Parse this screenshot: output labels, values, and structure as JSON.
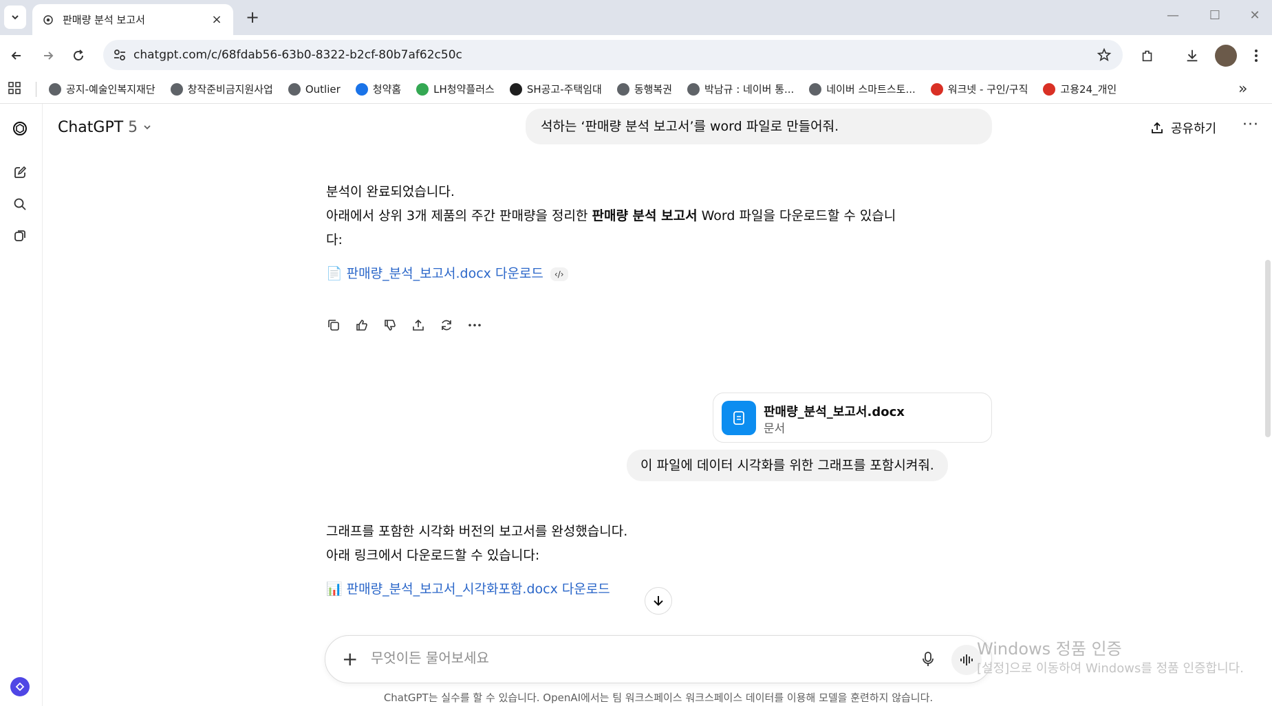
{
  "browser": {
    "tab_title": "판매량 분석 보고서",
    "close_glyph": "×",
    "new_tab_glyph": "+",
    "url": "chatgpt.com/c/68fdab56-63b0-8322-b2cf-80b7af62c50c",
    "bookmarks": [
      {
        "label": "공지-예술인복지재단",
        "color": "#5f6368"
      },
      {
        "label": "창작준비금지원사업",
        "color": "#5f6368"
      },
      {
        "label": "Outlier",
        "color": "#5f6368"
      },
      {
        "label": "청약홈",
        "color": "#1a73e8"
      },
      {
        "label": "LH청약플러스",
        "color": "#34a853"
      },
      {
        "label": "SH공고-주택임대",
        "color": "#1f1f1f"
      },
      {
        "label": "동행복권",
        "color": "#5f6368"
      },
      {
        "label": "박남규 : 네이버 통...",
        "color": "#5f6368"
      },
      {
        "label": "네이버 스마트스토...",
        "color": "#5f6368"
      },
      {
        "label": "워크넷 - 구인/구직",
        "color": "#d93025"
      },
      {
        "label": "고용24_개인",
        "color": "#d93025"
      }
    ],
    "more_glyph": "»"
  },
  "header": {
    "model_name": "ChatGPT",
    "model_version": "5",
    "share_label": "공유하기",
    "more_glyph": "···"
  },
  "conversation": {
    "user_msg_1_line1": "석하는 ‘판매량 분석 보고서’를 word 파일로 만들어줘.",
    "asst_1_line1": "분석이 완료되었습니다.",
    "asst_1_line2_pre": "아래에서 상위 3개 제품의 주간 판매량을 정리한 ",
    "asst_1_line2_bold": "판매량 분석 보고서",
    "asst_1_line2_post": " Word 파일을 다운로드할 수 있습니",
    "asst_1_line3": "다:",
    "asst_1_link_icon": "📄",
    "asst_1_link": "판매량_분석_보고서.docx 다운로드",
    "code_glyph": "‹/›",
    "file_name": "판매량_분석_보고서.docx",
    "file_type": "문서",
    "user_msg_2": "이 파일에 데이터 시각화를 위한 그래프를 포함시켜줘.",
    "asst_2_line1": "그래프를 포함한 시각화 버전의 보고서를 완성했습니다.",
    "asst_2_line2": "아래 링크에서 다운로드할 수 있습니다:",
    "asst_2_link_icon": "📊",
    "asst_2_link": "판매량_분석_보고서_시각화포함.docx 다운로드"
  },
  "composer": {
    "plus_glyph": "+",
    "placeholder": "무엇이든 물어보세요"
  },
  "footer": {
    "text": "ChatGPT는 실수를 할 수 있습니다. OpenAI에서는 팀 워크스페이스 워크스페이스 데이터를 이용해 모델을 훈련하지 않습니다."
  },
  "watermark": {
    "line1": "Windows 정품 인증",
    "line2": "[설정]으로 이동하여 Windows를 정품 인증합니다."
  },
  "colors": {
    "link": "#2b67c9",
    "file_icon_bg": "#0c8df0",
    "chrome_bg": "#dfe3eb"
  }
}
